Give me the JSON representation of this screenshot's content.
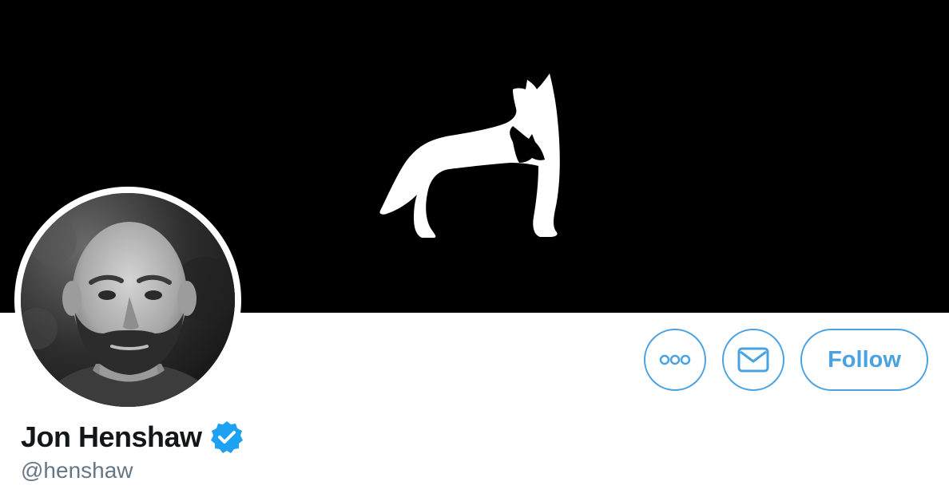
{
  "profile": {
    "display_name": "Jon Henshaw",
    "handle": "@henshaw",
    "verified": true
  },
  "banner": {
    "logo": "fox-logo"
  },
  "actions": {
    "more_icon": "more-icon",
    "message_icon": "envelope-icon",
    "follow_label": "Follow"
  },
  "colors": {
    "accent": "#4aa3e0",
    "verified": "#1da1f2",
    "name": "#14171a",
    "handle": "#657786",
    "banner": "#000000"
  }
}
